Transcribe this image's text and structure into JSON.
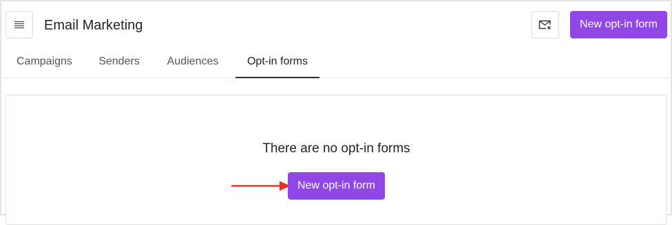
{
  "header": {
    "title": "Email Marketing",
    "menu_icon": "hamburger-menu-icon",
    "mail_icon": "mail-unsubscribe-icon",
    "new_button_label": "New opt-in form"
  },
  "tabs": [
    {
      "label": "Campaigns",
      "active": false
    },
    {
      "label": "Senders",
      "active": false
    },
    {
      "label": "Audiences",
      "active": false
    },
    {
      "label": "Opt-in forms",
      "active": true
    }
  ],
  "empty_state": {
    "message": "There are no opt-in forms",
    "button_label": "New opt-in form"
  },
  "colors": {
    "accent": "#9146e6",
    "annotation_arrow": "#e8321e"
  }
}
